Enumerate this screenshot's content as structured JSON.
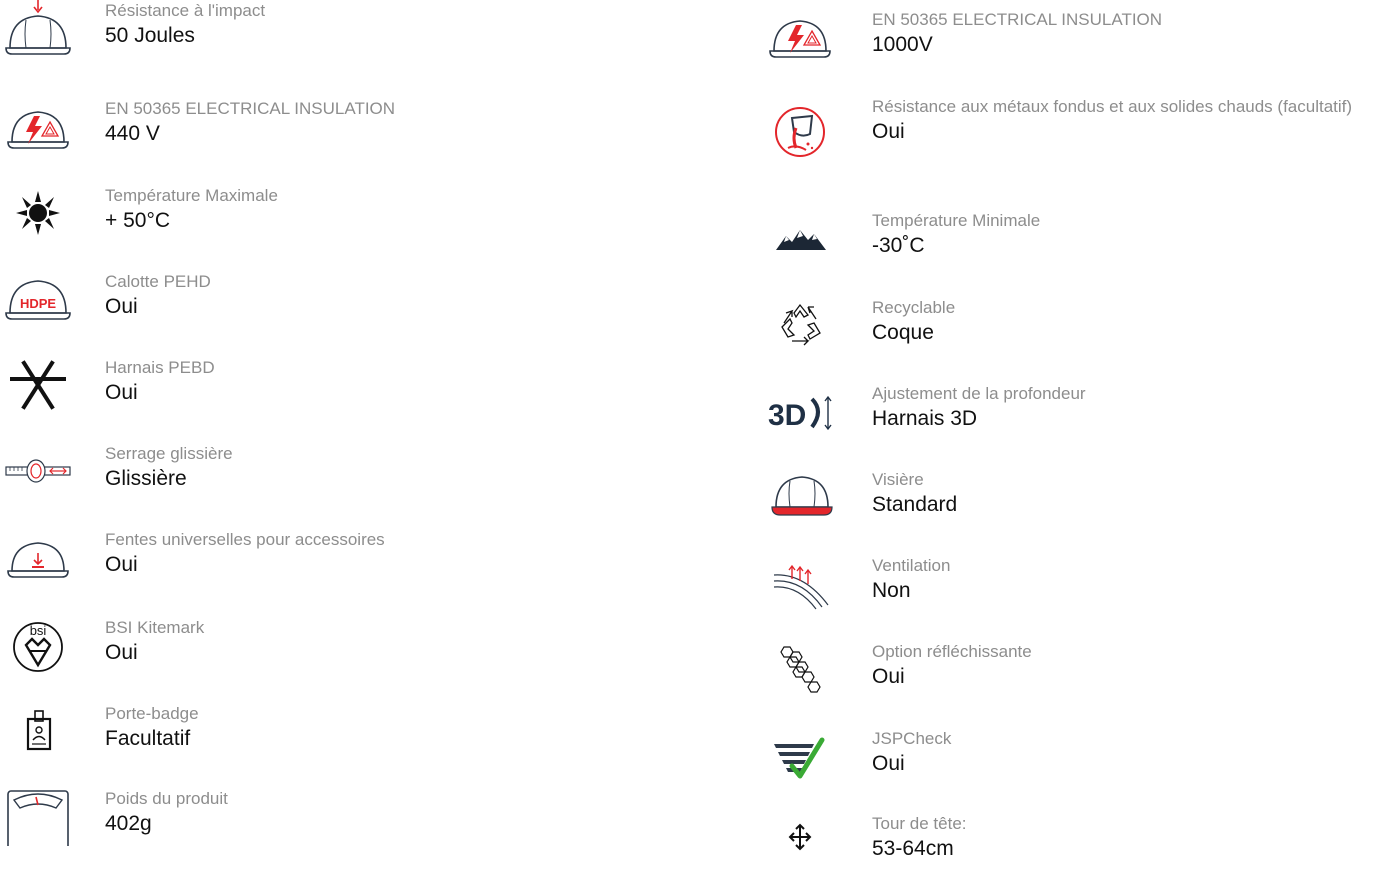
{
  "colors": {
    "accent": "#e3262b",
    "icon": "#2e3a4a",
    "check": "#3aaa35",
    "label": "#8d8d8d",
    "value": "#111111"
  },
  "left_specs": [
    {
      "icon": "helmet-impact-icon",
      "label": "Résistance à l'impact",
      "value": "50 Joules"
    },
    {
      "icon": "electrical-insulation-icon",
      "label": "EN 50365 ELECTRICAL INSULATION",
      "value": "440 V"
    },
    {
      "icon": "sun-heat-icon",
      "label": "Température Maximale",
      "value": "+ 50°C"
    },
    {
      "icon": "hdpe-shell-icon",
      "label": "Calotte PEHD",
      "value": "Oui"
    },
    {
      "icon": "harness-icon",
      "label": "Harnais PEBD",
      "value": "Oui"
    },
    {
      "icon": "slide-adjust-icon",
      "label": "Serrage glissière",
      "value": "Glissière"
    },
    {
      "icon": "accessory-slot-icon",
      "label": "Fentes universelles pour accessoires",
      "value": "Oui"
    },
    {
      "icon": "bsi-kitemark-icon",
      "label": "BSI Kitemark",
      "value": "Oui"
    },
    {
      "icon": "badge-holder-icon",
      "label": "Porte-badge",
      "value": "Facultatif"
    },
    {
      "icon": "weight-scale-icon",
      "label": "Poids du produit",
      "value": "402g"
    }
  ],
  "right_specs": [
    {
      "icon": "electrical-insulation-icon",
      "label": "EN 50365 ELECTRICAL INSULATION",
      "value": "1000V"
    },
    {
      "icon": "molten-metal-icon",
      "label": "Résistance aux métaux fondus et aux solides chauds (facultatif)",
      "value": "Oui"
    },
    {
      "icon": "mountain-cold-icon",
      "label": "Température Minimale",
      "value": "-30˚C"
    },
    {
      "icon": "recycle-icon",
      "label": "Recyclable",
      "value": "Coque"
    },
    {
      "icon": "depth-3d-icon",
      "label": "Ajustement de la profondeur",
      "value": "Harnais 3D"
    },
    {
      "icon": "visor-helmet-icon",
      "label": "Visière",
      "value": "Standard"
    },
    {
      "icon": "ventilation-icon",
      "label": "Ventilation",
      "value": "Non"
    },
    {
      "icon": "reflective-hex-icon",
      "label": "Option réfléchissante",
      "value": "Oui"
    },
    {
      "icon": "jspcheck-icon",
      "label": "JSPCheck",
      "value": "Oui"
    },
    {
      "icon": "head-size-icon",
      "label": "Tour de tête:",
      "value": "53-64cm"
    }
  ]
}
